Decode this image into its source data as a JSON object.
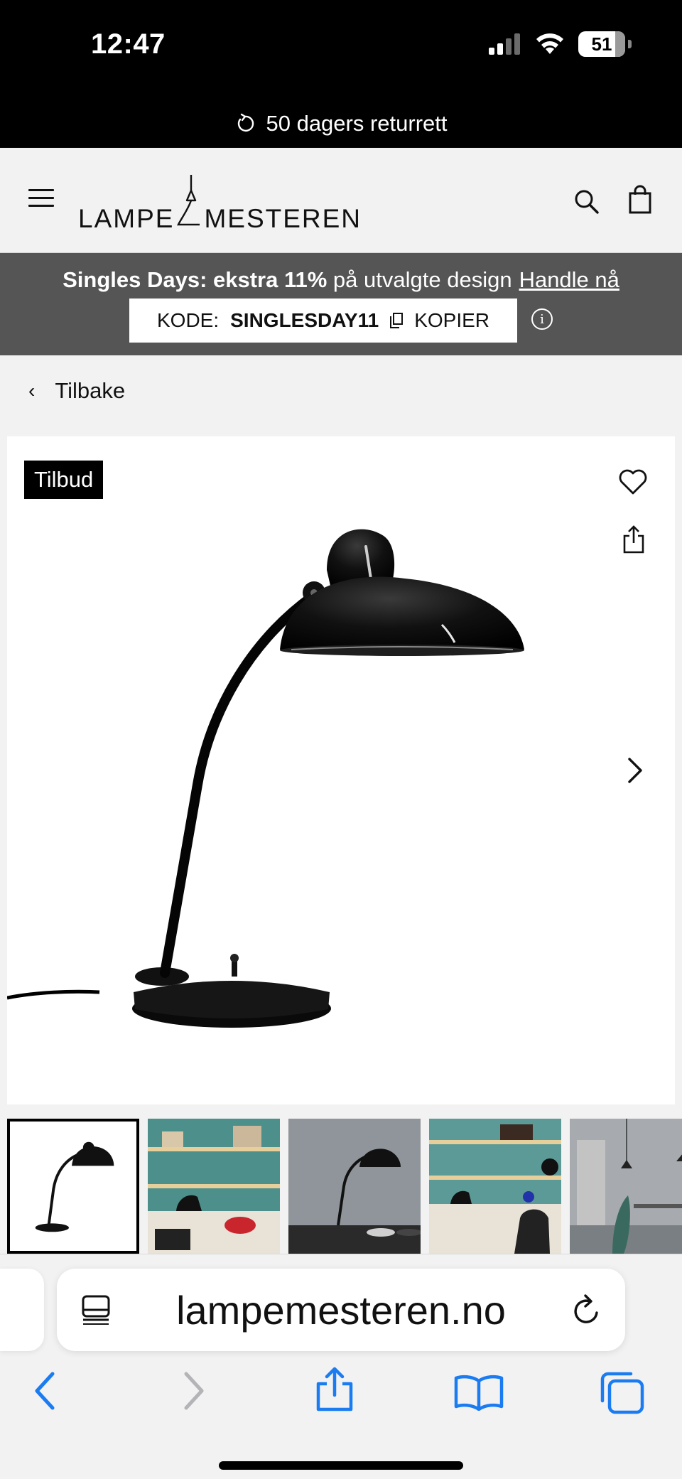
{
  "status_bar": {
    "time": "12:47",
    "battery": "51"
  },
  "return_banner": {
    "text": "50 dagers returrett"
  },
  "header": {
    "logo_left": "LAMPE",
    "logo_right": "MESTEREN"
  },
  "promo": {
    "headline_bold": "Singles Days: ekstra 11%",
    "headline_rest": " på utvalgte design",
    "link": "Handle nå",
    "code_label": "KODE:",
    "code": "SINGLESDAY11",
    "copy_label": "KOPIER",
    "info": "i"
  },
  "back": {
    "label": "Tilbake"
  },
  "product": {
    "badge": "Tilbud"
  },
  "thumbnails": [
    "lamp-white",
    "shelf-scene",
    "grey-desk",
    "shelf-chair",
    "dining-room"
  ],
  "browser": {
    "url": "lampemesteren.no"
  },
  "colors": {
    "promo_bg": "#555555",
    "black": "#000000",
    "link_blue": "#1a7cf0"
  }
}
